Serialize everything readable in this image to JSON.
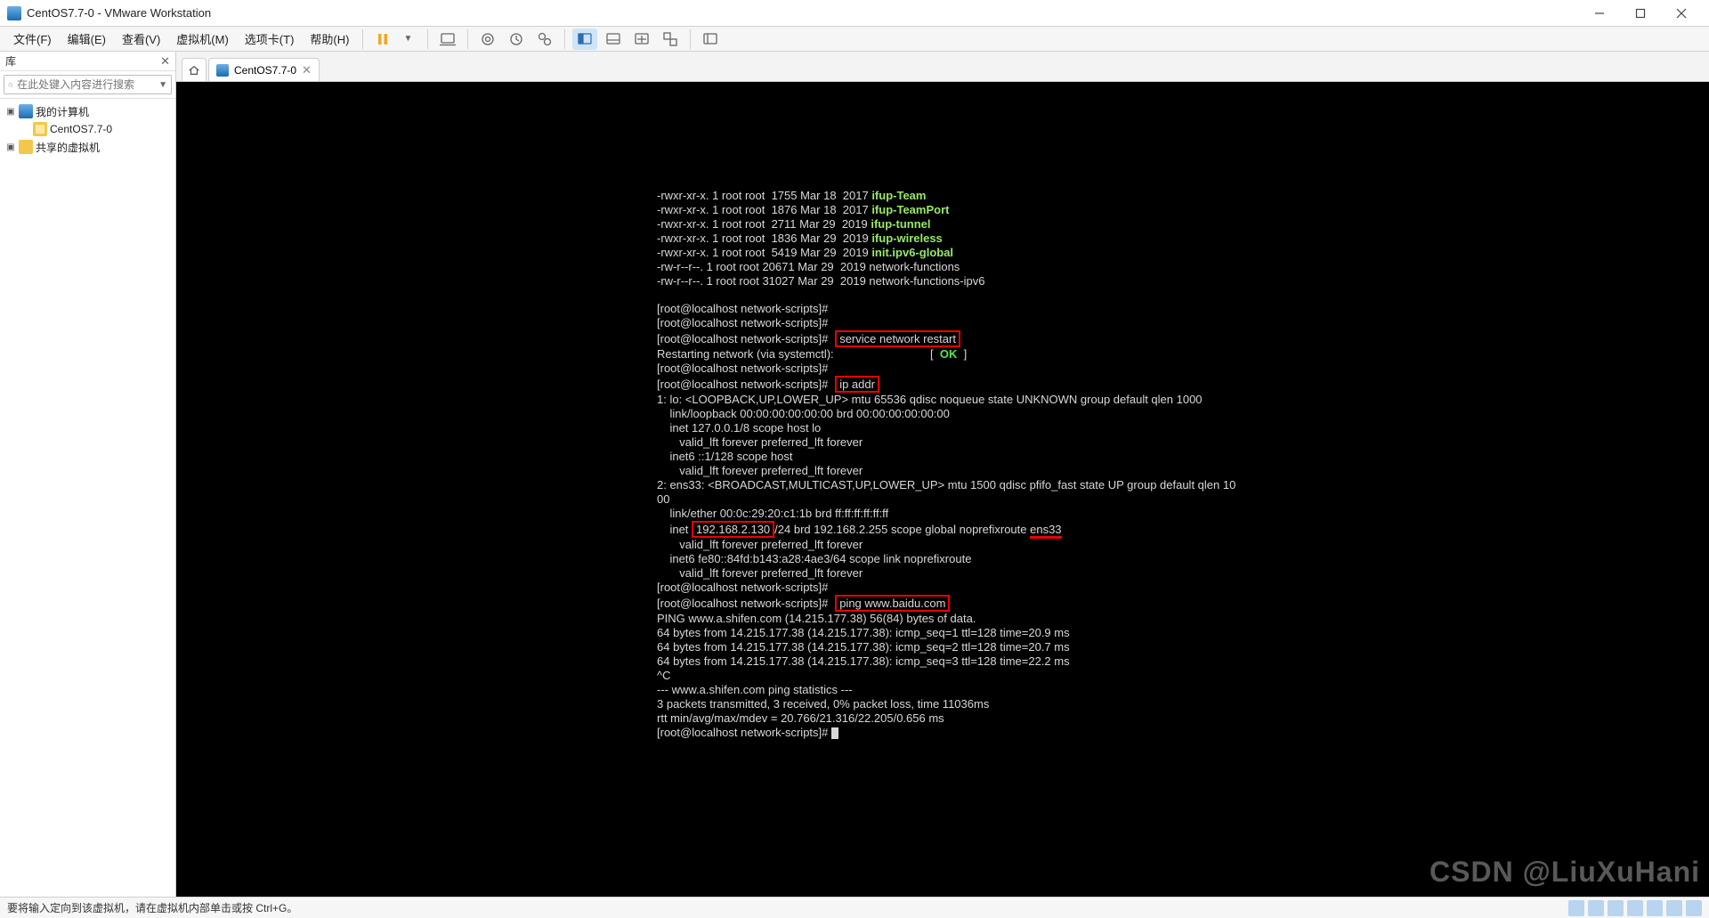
{
  "window": {
    "title": "CentOS7.7-0 - VMware Workstation"
  },
  "menu": {
    "file": "文件(F)",
    "edit": "编辑(E)",
    "view": "查看(V)",
    "vm": "虚拟机(M)",
    "tabs": "选项卡(T)",
    "help": "帮助(H)"
  },
  "library": {
    "title": "库",
    "search_placeholder": "在此处键入内容进行搜索",
    "tree": {
      "root": "我的计算机",
      "vm0": "CentOS7.7-0",
      "shared": "共享的虚拟机"
    }
  },
  "tabs": {
    "vm0": "CentOS7.7-0"
  },
  "terminal": {
    "ls": [
      {
        "perm": "-rwxr-xr-x. 1 root root  1755 Mar 18  2017 ",
        "name": "ifup-Team",
        "exec": true
      },
      {
        "perm": "-rwxr-xr-x. 1 root root  1876 Mar 18  2017 ",
        "name": "ifup-TeamPort",
        "exec": true
      },
      {
        "perm": "-rwxr-xr-x. 1 root root  2711 Mar 29  2019 ",
        "name": "ifup-tunnel",
        "exec": true
      },
      {
        "perm": "-rwxr-xr-x. 1 root root  1836 Mar 29  2019 ",
        "name": "ifup-wireless",
        "exec": true
      },
      {
        "perm": "-rwxr-xr-x. 1 root root  5419 Mar 29  2019 ",
        "name": "init.ipv6-global",
        "exec": true
      },
      {
        "perm": "-rw-r--r--. 1 root root 20671 Mar 29  2019 ",
        "name": "network-functions",
        "exec": false
      },
      {
        "perm": "-rw-r--r--. 1 root root 31027 Mar 29  2019 ",
        "name": "network-functions-ipv6",
        "exec": false
      }
    ],
    "prompt_blank": "[root@localhost network-scripts]#",
    "cmd_service": "service network restart",
    "restart_line_pre": "Restarting network (via systemctl):",
    "restart_ok_l": "[  ",
    "restart_ok": "OK",
    "restart_ok_r": "  ]",
    "cmd_ip": "ip addr",
    "ipaddr_lines_a": "1: lo: <LOOPBACK,UP,LOWER_UP> mtu 65536 qdisc noqueue state UNKNOWN group default qlen 1000\n    link/loopback 00:00:00:00:00:00 brd 00:00:00:00:00:00\n    inet 127.0.0.1/8 scope host lo\n       valid_lft forever preferred_lft forever\n    inet6 ::1/128 scope host \n       valid_lft forever preferred_lft forever\n2: ens33: <BROADCAST,MULTICAST,UP,LOWER_UP> mtu 1500 qdisc pfifo_fast state UP group default qlen 10\n00\n    link/ether 00:0c:29:20:c1:1b brd ff:ff:ff:ff:ff:ff",
    "inet_pre": "    inet ",
    "inet_ip": "192.168.2.130",
    "inet_mid": "/24 brd 192.168.2.255 scope global noprefixroute ",
    "inet_iface": "ens33",
    "ipaddr_lines_b": "       valid_lft forever preferred_lft forever\n    inet6 fe80::84fd:b143:a28:4ae3/64 scope link noprefixroute \n       valid_lft forever preferred_lft forever",
    "cmd_ping": "ping www.baidu.com",
    "ping_lines": "PING www.a.shifen.com (14.215.177.38) 56(84) bytes of data.\n64 bytes from 14.215.177.38 (14.215.177.38): icmp_seq=1 ttl=128 time=20.9 ms\n64 bytes from 14.215.177.38 (14.215.177.38): icmp_seq=2 ttl=128 time=20.7 ms\n64 bytes from 14.215.177.38 (14.215.177.38): icmp_seq=3 ttl=128 time=22.2 ms\n^C\n--- www.a.shifen.com ping statistics ---\n3 packets transmitted, 3 received, 0% packet loss, time 11036ms\nrtt min/avg/max/mdev = 20.766/21.316/22.205/0.656 ms",
    "prompt_cursor": "[root@localhost network-scripts]# "
  },
  "statusbar": {
    "hint": "要将输入定向到该虚拟机，请在虚拟机内部单击或按 Ctrl+G。"
  },
  "watermark": "CSDN @LiuXuHani"
}
